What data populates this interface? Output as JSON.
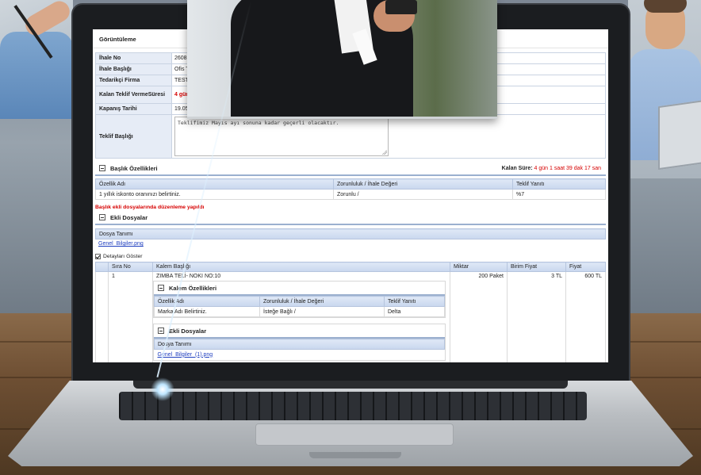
{
  "view_title": "Görüntüleme",
  "info": {
    "rows": [
      {
        "label": "İhale No",
        "value": "26081"
      },
      {
        "label": "İhale Başlığı",
        "value": "Ofis T"
      },
      {
        "label": "Tedarikçi Firma",
        "value": "TEST"
      },
      {
        "label": "Kalan Teklif VermeSüresi",
        "value": "4 gün"
      },
      {
        "label": "Kapanış Tarihi",
        "value": "19.05"
      }
    ],
    "offer_label": "Teklif Başlığı",
    "offer_text": "Teklifimiz Mayıs ayı sonuna kadar geçerli olacaktır."
  },
  "header_features": {
    "title": "Başlık Özellikleri",
    "remaining_label": "Kalan Süre:",
    "remaining_value": "4 gün 1 saat 39 dak 17 san",
    "columns": [
      "Özellik Adı",
      "Zorunluluk / İhale Değeri",
      "Teklif Yanıtı"
    ],
    "rows": [
      [
        "1 yıllık iskonto oranınızı belirtiniz.",
        "Zorunlu /",
        "%7"
      ]
    ]
  },
  "notice": "Başlık ekli dosyalarında düzenleme yapıldı",
  "attached_files": {
    "title": "Ekli Dosyalar",
    "column": "Dosya Tanımı",
    "file": "Genel_Bilgiler.png"
  },
  "show_details": "Detayları Göster",
  "items": {
    "columns": [
      "Sıra No",
      "Kalem Başlığı",
      "Miktar",
      "Birim Fiyat",
      "Fiyat"
    ],
    "rows": [
      {
        "no": "1",
        "title": "ZIMBA TELİ- NOKI NO:10",
        "qty": "200 Paket",
        "unit_price": "3 TL",
        "price": "600 TL"
      }
    ]
  },
  "item_features": {
    "title": "Kalem Özellikleri",
    "columns": [
      "Özellik Adı",
      "Zorunluluk / İhale Değeri",
      "Teklif Yanıtı"
    ],
    "rows": [
      [
        "Marka Adı Belirtiniz.",
        "İsteğe Bağlı /",
        "Delta"
      ]
    ]
  },
  "item_files": {
    "title": "Ekli Dosyalar",
    "column": "Dosya Tanımı",
    "file": "Genel_Bilgiler_(1).png"
  },
  "colors": {
    "accent_red": "#d60000",
    "header_blue": "#c9d7ee",
    "label_bg": "#e6ecf6",
    "link_blue": "#1f3fbf"
  }
}
